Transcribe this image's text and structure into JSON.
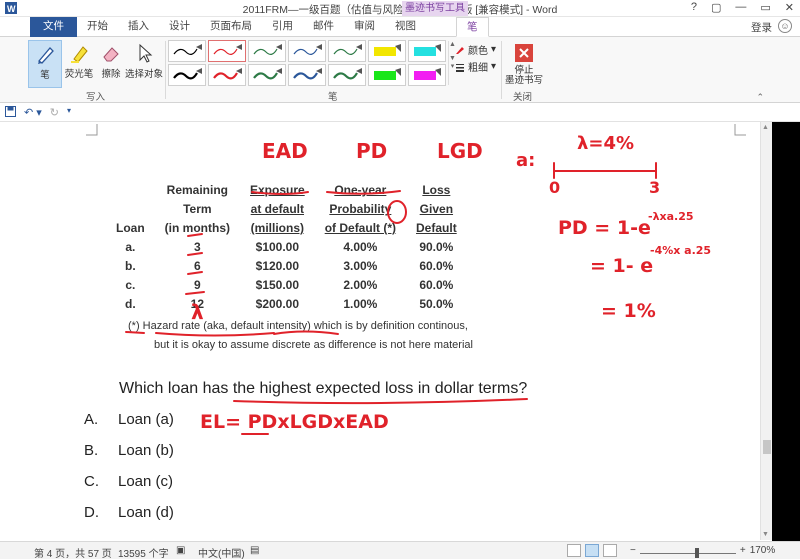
{
  "window": {
    "title": "2011FRM—一级百题（估值与风险模型）_授课版 [兼容模式] - Word",
    "controls": [
      "?",
      "▢",
      "—",
      "▭",
      "✕"
    ]
  },
  "tabs": {
    "file": "文件",
    "items": [
      "开始",
      "插入",
      "设计",
      "页面布局",
      "引用",
      "邮件",
      "审阅",
      "视图"
    ],
    "context_title": "墨迹书写工具",
    "active": "笔",
    "login": "登录"
  },
  "ribbon": {
    "write_group": {
      "label": "写入",
      "buttons": [
        "笔",
        "荧光笔",
        "擦除",
        "选择对象"
      ]
    },
    "pen_group": {
      "label": "笔",
      "color_label": "颜色",
      "weight_label": "粗细"
    },
    "close_group": {
      "label": "关闭",
      "stop_label": "停止\n墨迹书写"
    },
    "pen_colors": [
      "#000000",
      "#e0222a",
      "#2d7a46",
      "#2b579a",
      "#2d7a46",
      "#f2e600",
      "#24e0e0",
      "#000000",
      "#e0222a",
      "#2d7a46",
      "#2b579a",
      "#2d7a46",
      "#19e619",
      "#f21ef2"
    ]
  },
  "table": {
    "headers": [
      {
        "lines": [
          "",
          "",
          "Loan"
        ]
      },
      {
        "lines": [
          "Remaining",
          "Term",
          "(in months)"
        ]
      },
      {
        "lines": [
          "",
          "Exposure",
          "at default",
          "(millions)"
        ],
        "underline": true
      },
      {
        "lines": [
          "",
          "One-year",
          "Probability",
          "of Default (*)"
        ],
        "underline": true
      },
      {
        "lines": [
          "",
          "Loss",
          "Given",
          "Default"
        ],
        "underline": true
      }
    ],
    "rows": [
      [
        "a.",
        "3",
        "$100.00",
        "4.00%",
        "90.0%"
      ],
      [
        "b.",
        "6",
        "$120.00",
        "3.00%",
        "60.0%"
      ],
      [
        "c.",
        "9",
        "$150.00",
        "2.00%",
        "60.0%"
      ],
      [
        "d.",
        "12",
        "$200.00",
        "1.00%",
        "50.0%"
      ]
    ]
  },
  "note": {
    "line1": "(*)  Hazard rate (aka, default intensity) which is by definition continous,",
    "line2": "but it is okay to assume discrete as difference is not here material"
  },
  "question": "Which loan has the highest expected loss in dollar terms?",
  "choices": [
    {
      "letter": "A.",
      "text": "Loan (a)"
    },
    {
      "letter": "B.",
      "text": "Loan (b)"
    },
    {
      "letter": "C.",
      "text": "Loan (c)"
    },
    {
      "letter": "D.",
      "text": "Loan (d)"
    }
  ],
  "handwriting": {
    "ead": "EAD",
    "pd": "PD",
    "lgd": "LGD",
    "lambda": "λ",
    "a_label": "a:",
    "hazard": "λ=4%",
    "t0": "0",
    "t3": "3",
    "pd_formula": "PD = 1-e",
    "pd_exp": "-λxa.25",
    "step2": "= 1- e",
    "step2_exp": "-4%x a.25",
    "step3": "= 1%",
    "el_formula": "EL= PDxLGDxEAD"
  },
  "status": {
    "page": "第 4 页，共 57 页",
    "words": "13595 个字",
    "lang": "中文(中国)",
    "zoom": "170%",
    "zoom_fraction": 0.6
  }
}
